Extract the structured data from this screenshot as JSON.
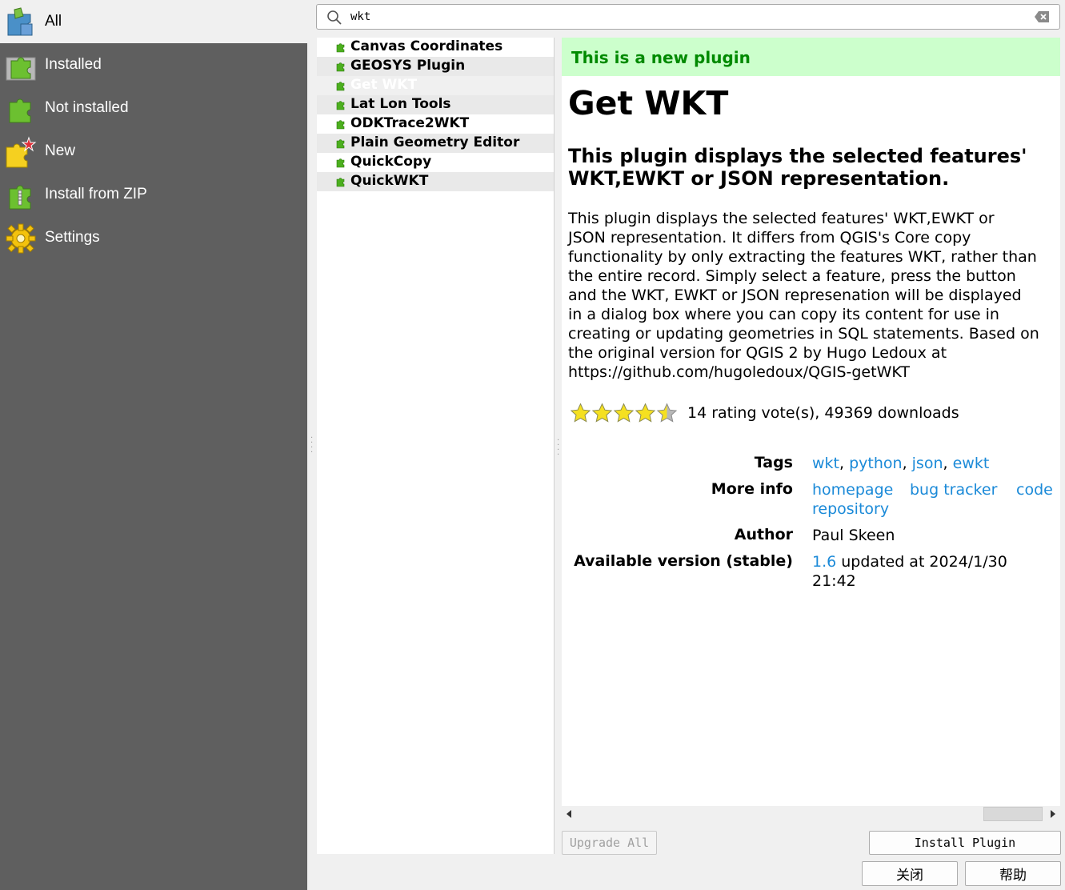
{
  "sidebar": {
    "items": [
      {
        "label": "All",
        "icon": "puzzle-all-icon"
      },
      {
        "label": "Installed",
        "icon": "puzzle-installed-icon"
      },
      {
        "label": "Not installed",
        "icon": "puzzle-not-installed-icon"
      },
      {
        "label": "New",
        "icon": "puzzle-new-icon"
      },
      {
        "label": "Install from ZIP",
        "icon": "puzzle-zip-icon"
      },
      {
        "label": "Settings",
        "icon": "gear-icon"
      }
    ],
    "selected_index": 0
  },
  "search": {
    "value": "wkt",
    "placeholder": ""
  },
  "plugins": [
    {
      "name": "Canvas Coordinates"
    },
    {
      "name": "GEOSYS Plugin"
    },
    {
      "name": "Get WKT"
    },
    {
      "name": "Lat Lon Tools"
    },
    {
      "name": "ODKTrace2WKT"
    },
    {
      "name": "Plain Geometry Editor"
    },
    {
      "name": "QuickCopy"
    },
    {
      "name": "QuickWKT"
    }
  ],
  "selected_plugin_index": 2,
  "details": {
    "banner": "This is a new plugin",
    "title": "Get WKT",
    "subtitle": "This plugin displays the selected features' WKT,EWKT or JSON representation.",
    "description": "This plugin displays the selected features' WKT,EWKT or\nJSON representation. It differs from QGIS's Core copy\nfunctionality by only extracting the features WKT, rather than\nthe entire record. Simply select a feature, press the button\nand the WKT, EWKT or JSON represenation will be displayed\nin a dialog box where you can copy its content for use in\ncreating or updating geometries in SQL statements. Based on\nthe original version for QGIS 2 by Hugo Ledoux at\nhttps://github.com/hugoledoux/QGIS-getWKT",
    "rating_stars": 4.5,
    "rating_text": "14 rating vote(s), 49369 downloads",
    "tags_label": "Tags",
    "tags": [
      "wkt",
      "python",
      "json",
      "ewkt"
    ],
    "more_info_label": "More info",
    "more_info_links": [
      "homepage",
      "bug tracker",
      "code",
      "repository"
    ],
    "author_label": "Author",
    "author": "Paul Skeen",
    "version_label": "Available version (stable)",
    "version": "1.6",
    "version_updated": " updated at 2024/1/30",
    "version_time": "21:42"
  },
  "buttons": {
    "upgrade_all": "Upgrade All",
    "install_plugin": "Install Plugin",
    "close": "关闭",
    "help": "帮助"
  },
  "colors": {
    "sidebar_bg": "#5f5f5f",
    "banner_bg": "#ccffcc",
    "banner_text": "#008a00",
    "link": "#1b8ad8",
    "plugin_icon": "#4caf1e"
  }
}
